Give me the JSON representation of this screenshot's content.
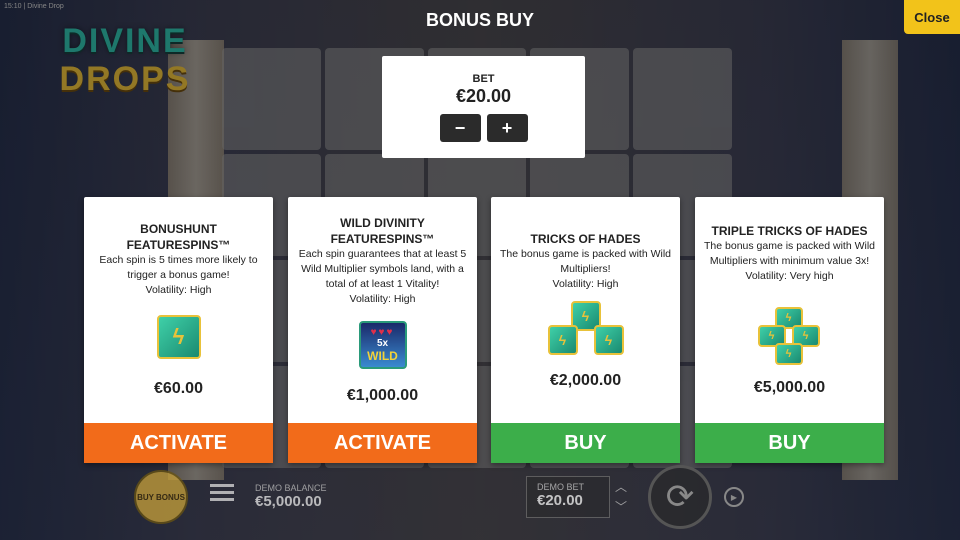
{
  "header": {
    "status_text": "15:10 | Divine Drop",
    "title": "BONUS BUY",
    "close_label": "Close"
  },
  "logo": {
    "line1": "DIVINE",
    "line2": "DROPS"
  },
  "bet": {
    "label": "BET",
    "value": "€20.00",
    "minus_label": "−",
    "plus_label": "+"
  },
  "cards": [
    {
      "title": "BONUSHUNT FEATURESPINS™",
      "description": "Each spin is 5 times more likely to trigger a bonus game!",
      "volatility": "Volatility: High",
      "price": "€60.00",
      "button": "ACTIVATE",
      "button_color": "#f26b1a",
      "icon": "zeus-symbol-icon"
    },
    {
      "title": "WILD DIVINITY FEATURESPINS™",
      "description": "Each spin guarantees that at least 5 Wild Multiplier symbols land, with a total of at least 1 Vitality!",
      "volatility": "Volatility: High",
      "price": "€1,000.00",
      "button": "ACTIVATE",
      "button_color": "#f26b1a",
      "icon": "wild-multiplier-icon",
      "icon_text": "WILD",
      "icon_mult": "5x"
    },
    {
      "title": "TRICKS OF HADES",
      "description": "The bonus game is packed with Wild Multipliers!",
      "volatility": "Volatility: High",
      "price": "€2,000.00",
      "button": "BUY",
      "button_color": "#3cae4a",
      "icon": "triple-zeus-symbol-icon"
    },
    {
      "title": "TRIPLE TRICKS OF HADES",
      "description": "The bonus game is packed with Wild Multipliers with minimum value 3x!",
      "volatility": "Volatility: Very high",
      "price": "€5,000.00",
      "button": "BUY",
      "button_color": "#3cae4a",
      "icon": "cross-zeus-symbol-icon"
    }
  ],
  "footer": {
    "buy_bonus_label": "BUY BONUS",
    "balance_label": "DEMO BALANCE",
    "balance_value": "€5,000.00",
    "bet_label": "DEMO BET",
    "bet_value": "€20.00"
  }
}
